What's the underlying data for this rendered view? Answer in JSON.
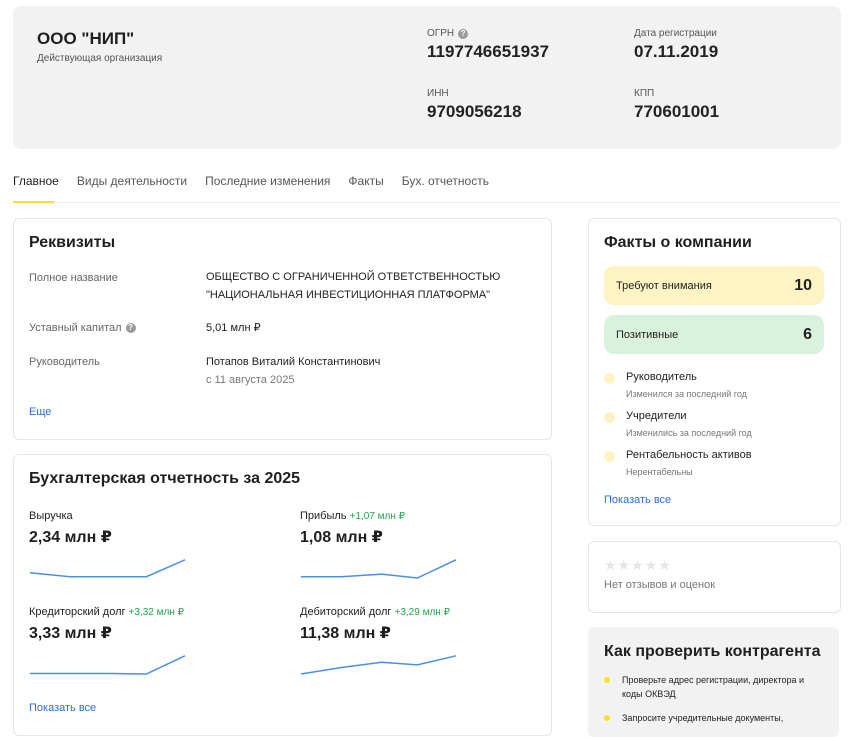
{
  "company": {
    "name": "ООО \"НИП\"",
    "status": "Действующая организация",
    "ogrn_label": "ОГРН",
    "ogrn": "1197746651937",
    "reg_date_label": "Дата регистрации",
    "reg_date": "07.11.2019",
    "inn_label": "ИНН",
    "inn": "9709056218",
    "kpp_label": "КПП",
    "kpp": "770601001"
  },
  "tabs": [
    "Главное",
    "Виды деятельности",
    "Последние изменения",
    "Факты",
    "Бух. отчетность"
  ],
  "requisites": {
    "title": "Реквизиты",
    "full_name_label": "Полное название",
    "full_name_line1": "ОБЩЕСТВО С ОГРАНИЧЕННОЙ ОТВЕТСТВЕННОСТЬЮ",
    "full_name_line2": "\"НАЦИОНАЛЬНАЯ ИНВЕСТИЦИОННАЯ ПЛАТФОРМА\"",
    "capital_label": "Уставный капитал",
    "capital": "5,01 млн ₽",
    "head_label": "Руководитель",
    "head_name": "Потапов Виталий Константинович",
    "head_since": "с 11 августа 2025",
    "more": "Еще"
  },
  "accounting": {
    "title": "Бухгалтерская отчетность за 2025",
    "show_all": "Показать все",
    "metrics": [
      {
        "label": "Выручка",
        "delta": "",
        "value": "2,34 млн ₽",
        "trend": [
          0.2,
          0.05,
          0.05,
          0.05,
          0.7
        ]
      },
      {
        "label": "Прибыль",
        "delta": "+1,07 млн ₽",
        "value": "1,08 млн ₽",
        "trend": [
          0.05,
          0.05,
          0.15,
          0.0,
          0.7
        ]
      },
      {
        "label": "Кредиторский долг",
        "delta": "+3,32 млн ₽",
        "value": "3,33 млн ₽",
        "trend": [
          0.02,
          0.02,
          0.02,
          0.0,
          0.7
        ]
      },
      {
        "label": "Дебиторский долг",
        "delta": "+3,29 млн ₽",
        "value": "11,38 млн ₽",
        "trend": [
          0.0,
          0.25,
          0.45,
          0.35,
          0.7
        ]
      }
    ]
  },
  "facts": {
    "title": "Факты о компании",
    "attention_label": "Требуют внимания",
    "attention_count": "10",
    "positive_label": "Позитивные",
    "positive_count": "6",
    "items": [
      {
        "title": "Руководитель",
        "sub": "Изменился за последний год"
      },
      {
        "title": "Учредители",
        "sub": "Изменились за последний год"
      },
      {
        "title": "Рентабельность активов",
        "sub": "Нерентабельны"
      }
    ],
    "show_all": "Показать все",
    "colors": {
      "attention_bg": "#fff3c4",
      "positive_bg": "#d8f2dd",
      "dot": "#fff3c4"
    }
  },
  "reviews": {
    "stars": "★★★★★",
    "text": "Нет отзывов и оценок"
  },
  "check": {
    "title": "Как проверить контрагента",
    "tips": [
      "Проверьте адрес регистрации, директора и коды ОКВЭД",
      "Запросите учредительные документы,"
    ]
  },
  "accent": {
    "yellow": "#ffdd2d",
    "blue": "#2b6fd6",
    "green": "#1ea64a",
    "spark": "#4a8fe7"
  }
}
